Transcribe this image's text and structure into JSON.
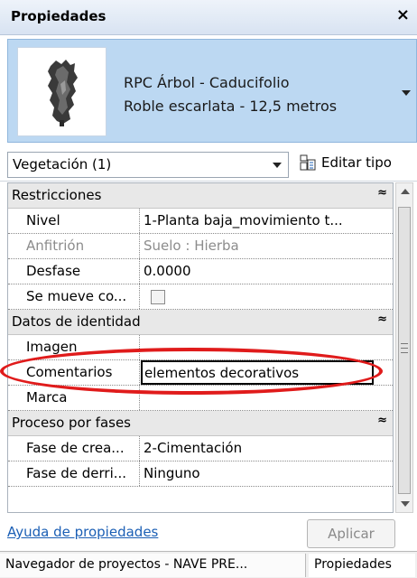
{
  "window": {
    "title": "Propiedades",
    "close_glyph": "×"
  },
  "type_selector": {
    "family": "RPC Árbol - Caducifolio",
    "type": "Roble escarlata - 12,5 metros",
    "thumbnail": "tree-preview-icon"
  },
  "instance_filter": {
    "value": "Vegetación (1)",
    "edit_type_label": "Editar tipo"
  },
  "groups": {
    "restricciones": {
      "label": "Restricciones",
      "collapse_glyph": "≈"
    },
    "identidad": {
      "label": "Datos de identidad",
      "collapse_glyph": "≈"
    },
    "fases": {
      "label": "Proceso por fases",
      "collapse_glyph": "≈"
    }
  },
  "properties": {
    "nivel": {
      "name": "Nivel",
      "value": "1-Planta baja_movimiento t..."
    },
    "anfitrion": {
      "name": "Anfitrión",
      "value": "Suelo : Hierba"
    },
    "desfase": {
      "name": "Desfase",
      "value": "0.0000"
    },
    "se_mueve": {
      "name": "Se mueve co...",
      "checked": false
    },
    "imagen": {
      "name": "Imagen",
      "value": ""
    },
    "comentarios": {
      "name": "Comentarios",
      "value": "elementos decorativos"
    },
    "marca": {
      "name": "Marca",
      "value": ""
    },
    "fase_creacion": {
      "name": "Fase de crea...",
      "value": "2-Cimentación"
    },
    "fase_derribo": {
      "name": "Fase de derri...",
      "value": "Ninguno"
    }
  },
  "footer": {
    "help_link": "Ayuda de propiedades",
    "apply_label": "Aplicar"
  },
  "bottom_tabs": [
    {
      "label": "Navegador de proyectos - NAVE PRE..."
    },
    {
      "label": "Propiedades"
    }
  ],
  "colors": {
    "annotation": "#e01b1b",
    "header_bg": "#bcd8f2",
    "link": "#1b5fb5"
  }
}
